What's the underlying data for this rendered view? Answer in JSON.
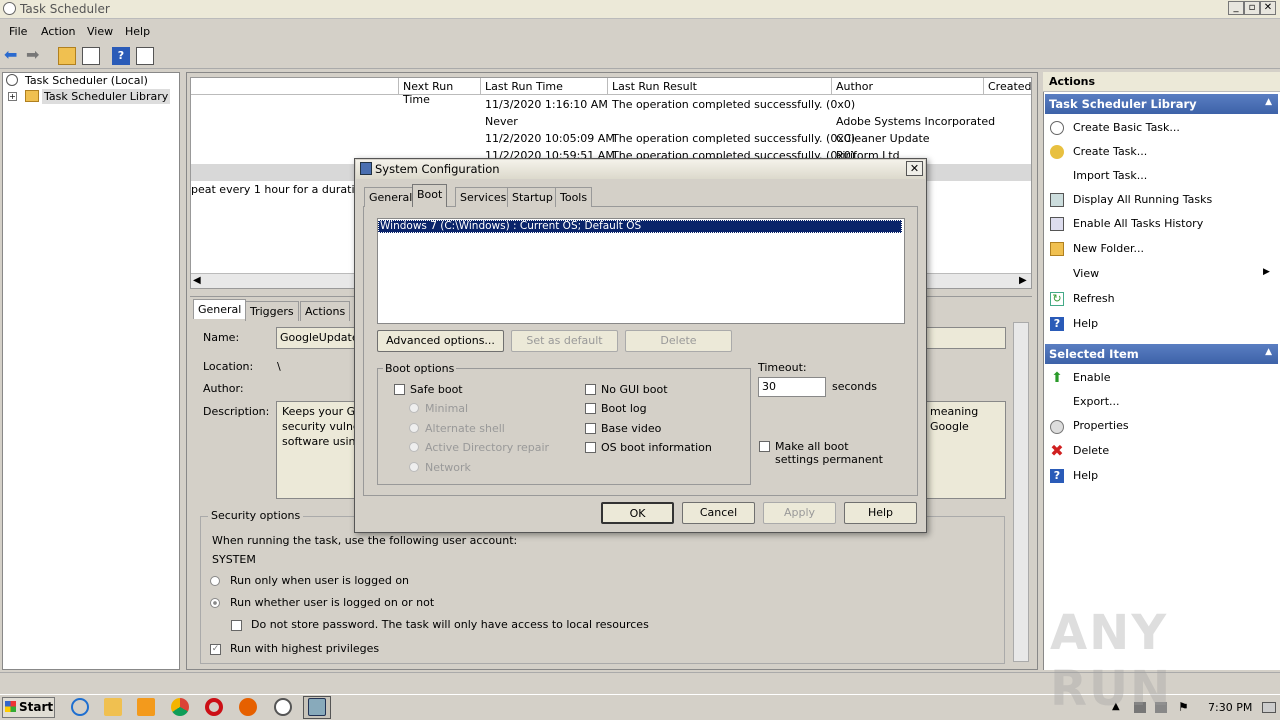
{
  "window": {
    "title": "Task Scheduler"
  },
  "menu": [
    "File",
    "Action",
    "View",
    "Help"
  ],
  "tree": {
    "root": "Task Scheduler (Local)",
    "child": "Task Scheduler Library"
  },
  "tasklist": {
    "columns": [
      "Next Run Time",
      "Last Run Time",
      "Last Run Result",
      "Author",
      "Created"
    ],
    "rows": [
      {
        "last_run": "11/3/2020 1:16:10 AM",
        "result": "The operation completed successfully. (0x0)",
        "author": ""
      },
      {
        "last_run": "Never",
        "result": "",
        "author": "Adobe Systems Incorporated"
      },
      {
        "last_run": "11/2/2020 10:05:09 AM",
        "result": "The operation completed successfully. (0x0)",
        "author": "CCleaner Update"
      },
      {
        "last_run": "11/2/2020 10:59:51 AM",
        "result": "The operation completed successfully. (0x0)",
        "author": "Piriform Ltd"
      }
    ],
    "trigger_text": "peat every 1 hour for a duration o"
  },
  "details": {
    "tabs": [
      "General",
      "Triggers",
      "Actions"
    ],
    "name_label": "Name:",
    "name_value": "GoogleUpdate",
    "location_label": "Location:",
    "location_value": "\\",
    "author_label": "Author:",
    "description_label": "Description:",
    "description_lines": [
      "Keeps your Go",
      "security vulne",
      "software usin"
    ],
    "description_right": [
      "meaning",
      "Google"
    ],
    "security": {
      "legend": "Security options",
      "account_prompt": "When running the task, use the following user account:",
      "account": "SYSTEM",
      "radio1": "Run only when user is logged on",
      "radio2": "Run whether user is logged on or not",
      "no_store": "Do not store password.  The task will only have access to local resources",
      "highest": "Run with highest privileges"
    }
  },
  "actions_pane": {
    "header": "Actions",
    "section1": "Task Scheduler Library",
    "items1": [
      "Create Basic Task...",
      "Create Task...",
      "Import Task...",
      "Display All Running Tasks",
      "Enable All Tasks History",
      "New Folder...",
      "View",
      "Refresh",
      "Help"
    ],
    "section2": "Selected Item",
    "items2": [
      "Enable",
      "Export...",
      "Properties",
      "Delete",
      "Help"
    ]
  },
  "dialog": {
    "title": "System Configuration",
    "tabs": [
      "General",
      "Boot",
      "Services",
      "Startup",
      "Tools"
    ],
    "os_entry": "Windows 7 (C:\\Windows) : Current OS; Default OS",
    "btn_advanced": "Advanced options...",
    "btn_default": "Set as default",
    "btn_delete": "Delete",
    "boot_options": "Boot options",
    "safe_boot": "Safe boot",
    "minimal": "Minimal",
    "alt_shell": "Alternate shell",
    "ad_repair": "Active Directory repair",
    "network": "Network",
    "no_gui": "No GUI boot",
    "boot_log": "Boot log",
    "base_video": "Base video",
    "os_info": "OS boot information",
    "timeout_label": "Timeout:",
    "timeout_value": "30",
    "seconds": "seconds",
    "permanent": "Make all boot settings permanent",
    "ok": "OK",
    "cancel": "Cancel",
    "apply": "Apply",
    "help": "Help"
  },
  "taskbar": {
    "start": "Start",
    "clock": "7:30 PM"
  },
  "watermark": "ANY RUN"
}
